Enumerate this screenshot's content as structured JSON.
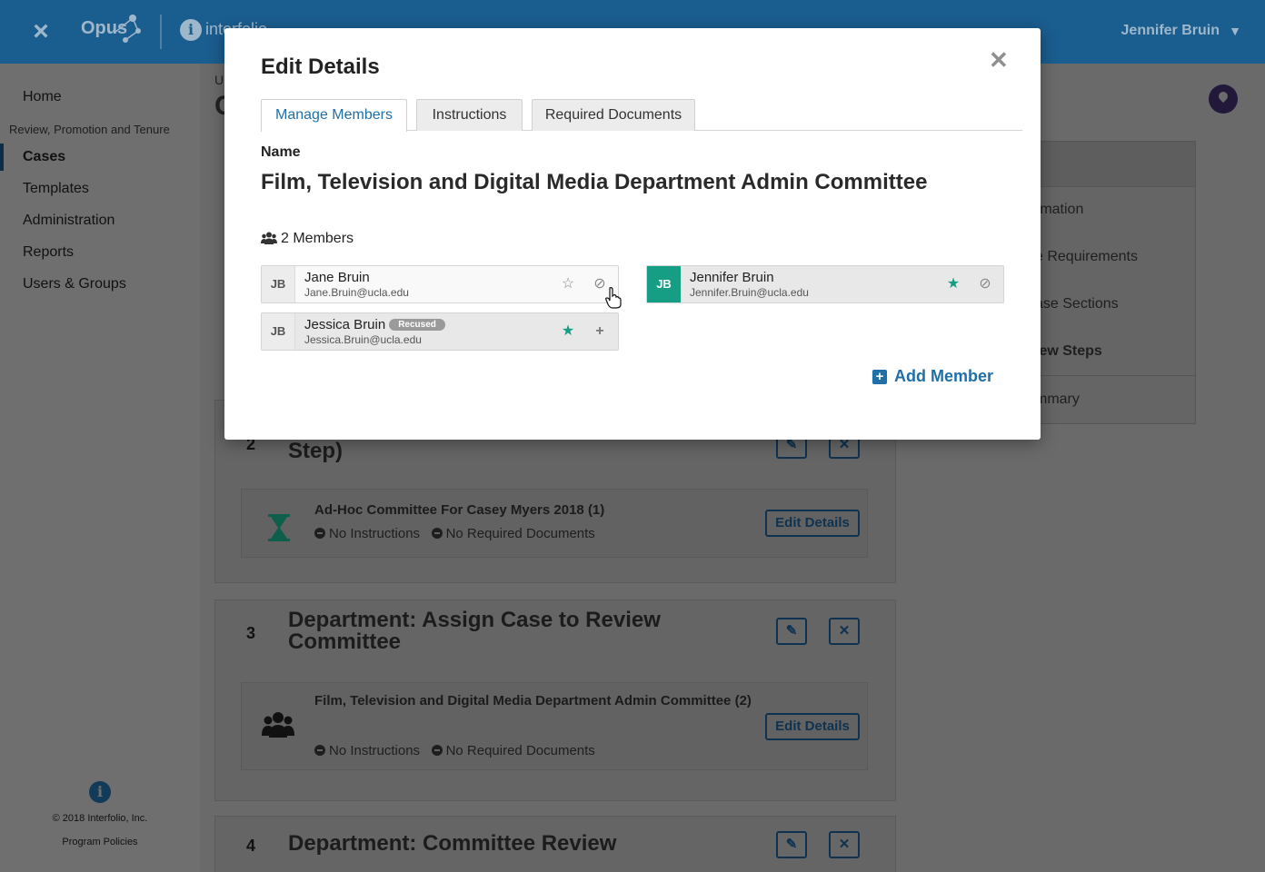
{
  "topbar": {
    "brand": "Opus",
    "secondary_brand": "interfolio",
    "user_name": "Jennifer Bruin"
  },
  "sidebar": {
    "items": [
      {
        "label": "Home"
      },
      {
        "label": "Review, Promotion and Tenure"
      },
      {
        "label": "Cases",
        "active": true
      },
      {
        "label": "Templates"
      },
      {
        "label": "Administration"
      },
      {
        "label": "Reports"
      },
      {
        "label": "Users & Groups"
      }
    ],
    "copyright": "© 2018 Interfolio, Inc.",
    "policies_link": "Program Policies"
  },
  "background": {
    "breadcrumb_fragment": "U",
    "title_fragment": "C",
    "right_panel": {
      "items": [
        "rmation",
        "e Requirements",
        "ase Sections",
        "iew Steps",
        "mmary"
      ]
    },
    "steps": [
      {
        "number": "2",
        "title_fragment": "Step)",
        "committee": "Ad-Hoc Committee For Casey Myers 2018 (1)",
        "instructions": "No Instructions",
        "documents": "No Required Documents",
        "button": "Edit Details"
      },
      {
        "number": "3",
        "title": "Department: Assign Case to Review Committee",
        "committee": "Film, Television and Digital Media Department Admin Committee (2)",
        "instructions": "No Instructions",
        "documents": "No Required Documents",
        "button": "Edit Details"
      },
      {
        "number": "4",
        "title": "Department: Committee Review"
      }
    ]
  },
  "modal": {
    "title": "Edit Details",
    "tabs": [
      {
        "label": "Manage Members",
        "active": true
      },
      {
        "label": "Instructions"
      },
      {
        "label": "Required Documents"
      }
    ],
    "name_label": "Name",
    "committee_name": "Film, Television and Digital Media Department Admin Committee",
    "members_count": "2 Members",
    "members": [
      {
        "initials": "JB",
        "name": "Jane Bruin",
        "email": "Jane.Bruin@ucla.edu",
        "starred": false,
        "action": "ban"
      },
      {
        "initials": "JB",
        "name": "Jennifer Bruin",
        "email": "Jennifer.Bruin@ucla.edu",
        "starred": true,
        "action": "ban",
        "highlight": true
      },
      {
        "initials": "JB",
        "name": "Jessica Bruin",
        "email": "Jessica.Bruin@ucla.edu",
        "badge": "Recused",
        "starred": true,
        "action": "add"
      }
    ],
    "add_member": "Add Member"
  },
  "colors": {
    "topbar": "#1a5d8f",
    "accent_blue": "#1f6fa8",
    "teal": "#159e84"
  }
}
